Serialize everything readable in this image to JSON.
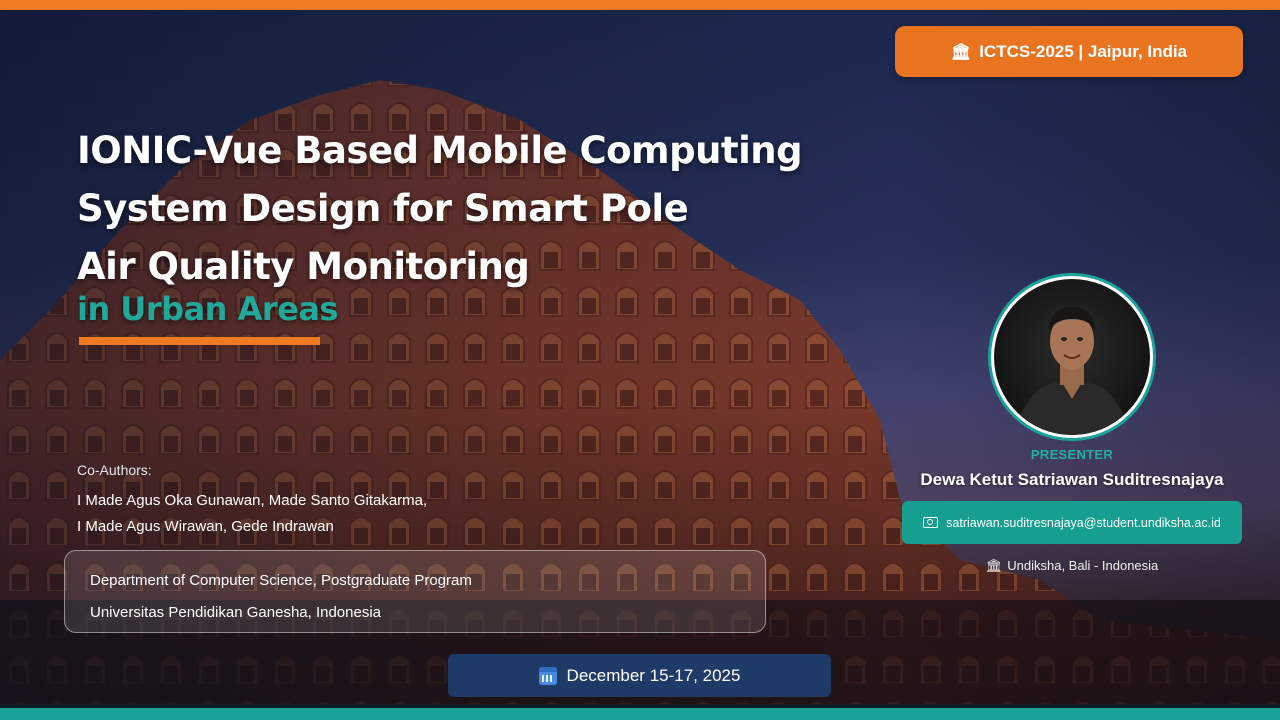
{
  "conference": {
    "icon": "institution-icon",
    "label": "ICTCS-2025 | Jaipur, India"
  },
  "title": {
    "lines": [
      "IONIC-Vue Based Mobile Computing",
      "System Design for Smart Pole",
      "Air Quality Monitoring"
    ],
    "subtitle": "in Urban Areas"
  },
  "coauthors": {
    "label": "Co-Authors:",
    "lines": [
      "I Made Agus Oka Gunawan, Made Santo Gitakarma,",
      "I Made Agus Wirawan, Gede Indrawan"
    ]
  },
  "affiliation": {
    "lines": [
      "Department of Computer Science, Postgraduate Program",
      "Universitas Pendidikan Ganesha, Indonesia"
    ]
  },
  "date": {
    "icon": "calendar-icon",
    "label": "December 15-17, 2025"
  },
  "presenter": {
    "label": "PRESENTER",
    "name": "Dewa Ketut Satriawan Suditresnajaya",
    "email_icon": "id-card-icon",
    "email": "satriawan.suditresnajaya@student.undiksha.ac.id",
    "institution_icon": "institution-icon",
    "institution": "Undiksha, Bali - Indonesia"
  },
  "colors": {
    "accent_orange": "#f07a22",
    "accent_teal": "#1aa39a",
    "date_bg": "#1e3a66"
  }
}
